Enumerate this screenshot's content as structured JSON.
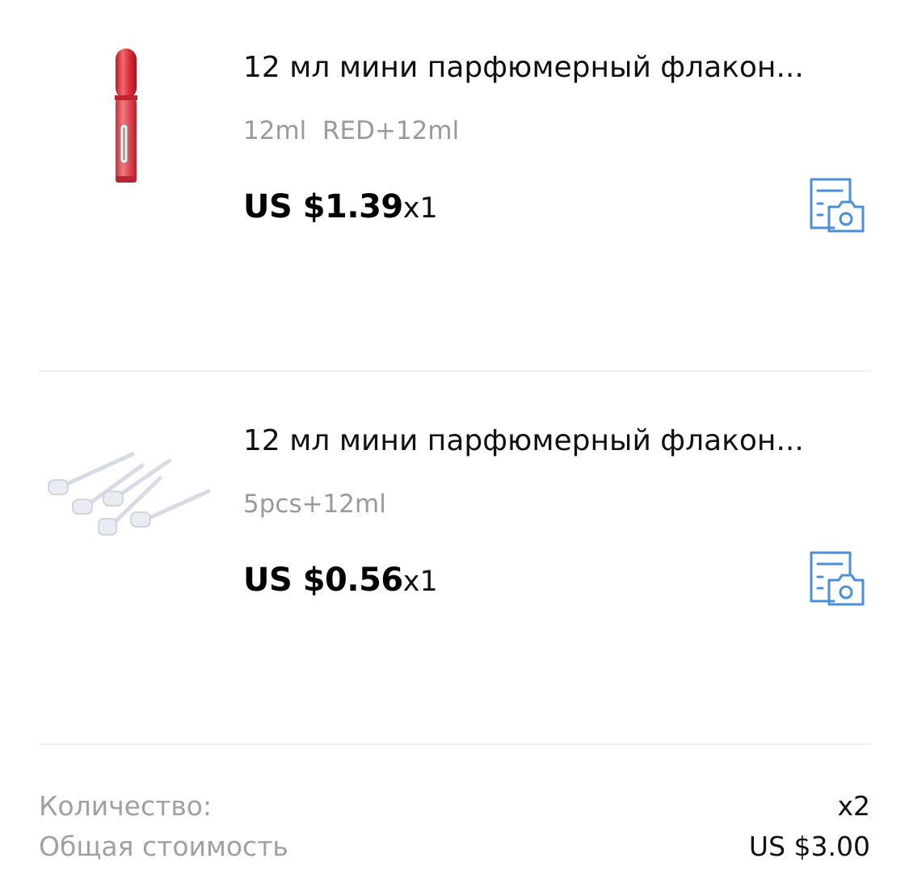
{
  "order_items": [
    {
      "title": "12 мл мини парфюмерный флакон...",
      "variant": "12ml  RED+12ml",
      "price": "US $1.39",
      "quantity": "x1",
      "image_icon": "red-perfume-atomizer-image",
      "review_icon": "photo-review-icon"
    },
    {
      "title": "12 мл мини парфюмерный флакон...",
      "variant": "5pcs+12ml",
      "price": "US $0.56",
      "quantity": "x1",
      "image_icon": "refill-pumps-image",
      "review_icon": "photo-review-icon"
    }
  ],
  "summary": {
    "quantity_label": "Количество:",
    "quantity_value": "x2",
    "total_label": "Общая стоимость",
    "total_value": "US $3.00"
  },
  "colors": {
    "accent_icon": "#4a8fd9",
    "bottle_red": "#d8323c",
    "muted_text": "#9a9a9a",
    "divider": "#efefef"
  }
}
